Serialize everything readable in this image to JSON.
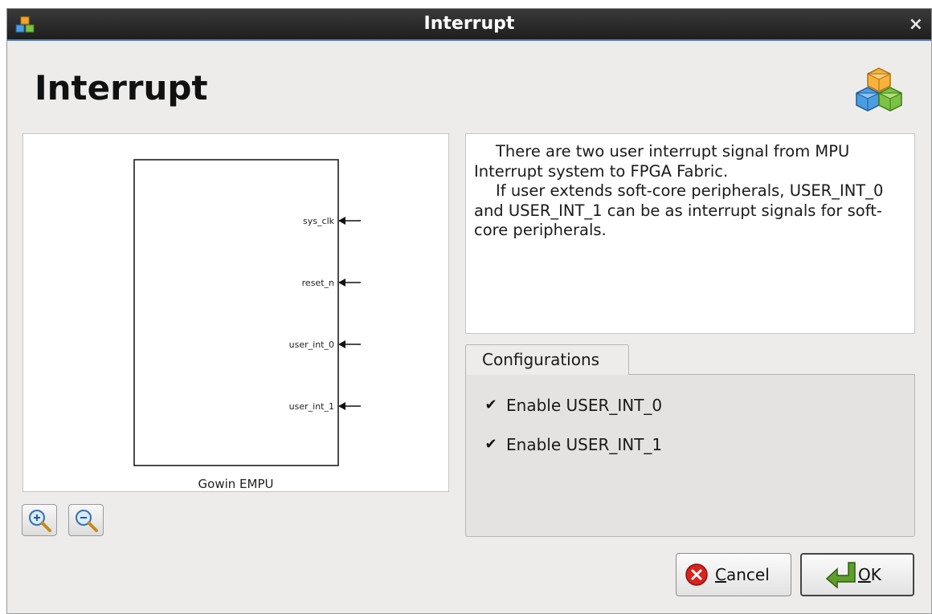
{
  "window": {
    "title": "Interrupt",
    "close_glyph": "×"
  },
  "header": {
    "title": "Interrupt",
    "icon": "cubes-icon"
  },
  "diagram": {
    "module_name": "Gowin EMPU",
    "ports": [
      "sys_clk",
      "reset_n",
      "user_int_0",
      "user_int_1"
    ],
    "zoom_in_icon": "zoom-in-icon",
    "zoom_out_icon": "zoom-out-icon"
  },
  "description": {
    "paragraphs": [
      "There are two user interrupt signal from MPU Interrupt system to FPGA Fabric.",
      "If user extends soft-core peripherals, USER_INT_0 and USER_INT_1 can be as interrupt signals for soft-core peripherals."
    ]
  },
  "configurations": {
    "tab_label": "Configurations",
    "options": [
      {
        "label": "Enable USER_INT_0",
        "checked": true
      },
      {
        "label": "Enable USER_INT_1",
        "checked": true
      }
    ]
  },
  "buttons": {
    "cancel_mnemonic": "C",
    "cancel_rest": "ancel",
    "ok_mnemonic": "O",
    "ok_rest": "K"
  },
  "colors": {
    "titlebar": "#2b2b2b",
    "accent": "#5a7fb5",
    "cancel_red": "#d8231f",
    "ok_green": "#5f9e2b"
  }
}
